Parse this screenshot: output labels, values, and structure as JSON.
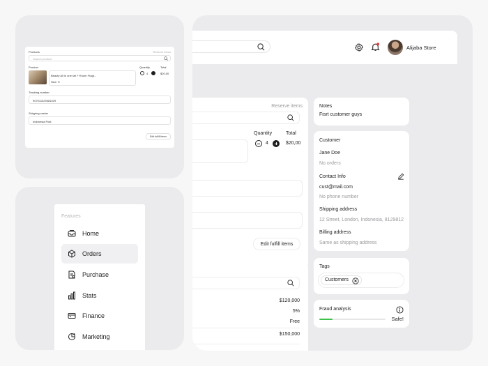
{
  "fulfill_card": {
    "products_label": "Products",
    "reserve_label": "Reserve items",
    "search_placeholder": "Search product",
    "product_col": "Product",
    "quantity_col": "Quantity",
    "total_col": "Total",
    "product_name": "Beauty All in one set + Room Fragr...",
    "product_size": "Size: S",
    "quantity": "4",
    "total": "$20,00",
    "tracking_label": "Tracking number",
    "tracking_value": "907011029381029",
    "carrier_label": "Shipping carrier",
    "carrier_value": "Indonesia Post",
    "button_label": "Edit fulfill items"
  },
  "sidebar": {
    "heading": "Features",
    "items": [
      {
        "label": "Home",
        "icon": "inbox-icon"
      },
      {
        "label": "Orders",
        "icon": "box-icon"
      },
      {
        "label": "Purchase",
        "icon": "receipt-icon"
      },
      {
        "label": "Stats",
        "icon": "bar-chart-icon"
      },
      {
        "label": "Finance",
        "icon": "card-icon"
      },
      {
        "label": "Marketing",
        "icon": "megaphone-icon"
      }
    ],
    "active_index": 1
  },
  "header": {
    "store_name": "Alijaba Store"
  },
  "order": {
    "reserve_label": "Reserve items",
    "quantity_col": "Quantity",
    "total_col": "Total",
    "quantity": "4",
    "total": "$20,00",
    "edit_button": "Edit fulfill items"
  },
  "summary": {
    "values": [
      "$120,000",
      "5%",
      "Free",
      "$150,000"
    ]
  },
  "notes": {
    "title": "Notes",
    "text": "Fisrt customer guys"
  },
  "customer": {
    "title": "Customer",
    "name": "Jane Doe",
    "orders": "No orders",
    "contact_title": "Contact Info",
    "email": "cust@mail.com",
    "phone": "No phone number",
    "shipping_title": "Shipping address",
    "shipping_value": "12 Street, London, Indonesia, 8129812",
    "billing_title": "Billing address",
    "billing_value": "Same as shipping address"
  },
  "tags": {
    "title": "Tags",
    "items": [
      "Customers"
    ]
  },
  "fraud": {
    "title": "Fraud analysis",
    "status": "Safe!",
    "level_fraction": 0.2,
    "bar_color": "#3cc24a"
  },
  "colors": {
    "accent_dark": "#1e1e1e",
    "notification_dot": "#e5383b",
    "panel_bg": "#ebebed"
  }
}
